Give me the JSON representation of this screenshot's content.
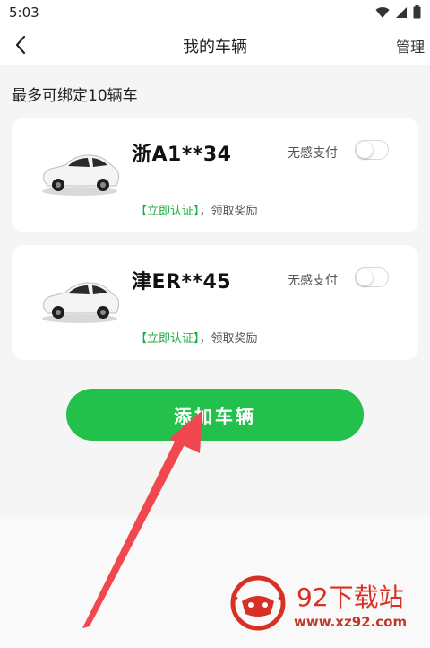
{
  "status_bar": {
    "time": "5:03"
  },
  "header": {
    "back_icon": "chevron-left-icon",
    "title": "我的车辆",
    "manage": "管理"
  },
  "main": {
    "limit_text": "最多可绑定10辆车",
    "vehicles": [
      {
        "plate": "浙A1**34",
        "pay_label": "无感支付",
        "pay_enabled": false,
        "verify_link": "【立即认证】",
        "verify_suffix": "，领取奖励"
      },
      {
        "plate": "津ER**45",
        "pay_label": "无感支付",
        "pay_enabled": false,
        "verify_link": "【立即认证】",
        "verify_suffix": "，领取奖励"
      }
    ],
    "add_button": "添加车辆"
  },
  "watermark": {
    "title": "92下载站",
    "url": "www.xz92.com"
  },
  "colors": {
    "accent_green": "#23c14c",
    "link_green": "#1aad3c",
    "arrow_red": "#f0484e",
    "watermark_red": "#d93025"
  }
}
